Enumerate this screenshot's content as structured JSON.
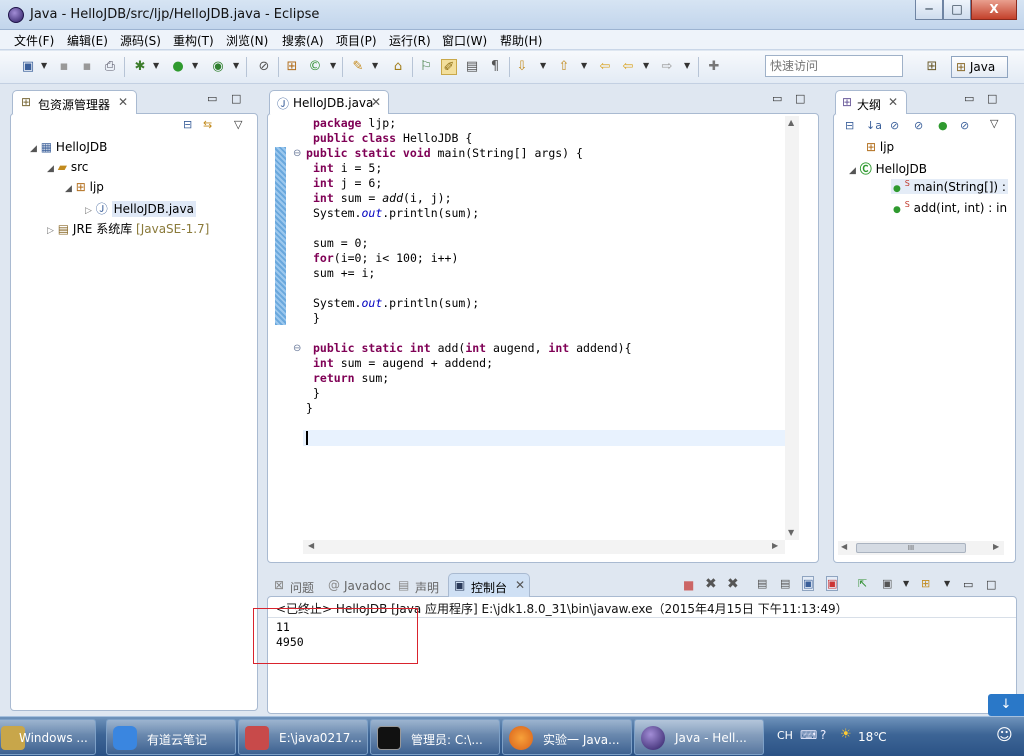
{
  "window": {
    "title": "Java  -  HelloJDB/src/ljp/HelloJDB.java  -  Eclipse",
    "controls": {
      "minimize": "─",
      "maximize": "□",
      "close": "X"
    }
  },
  "menu": [
    "文件(F)",
    "编辑(E)",
    "源码(S)",
    "重构(T)",
    "浏览(N)",
    "搜索(A)",
    "项目(P)",
    "运行(R)",
    "窗口(W)",
    "帮助(H)"
  ],
  "toolbar": {
    "quick_access_placeholder": "快速访问",
    "perspective_label": "Java"
  },
  "package_explorer": {
    "tab_label": "包资源管理器",
    "tree": {
      "project": "HelloJDB",
      "src": "src",
      "package": "ljp",
      "file": "HelloJDB.java",
      "jre": "JRE 系统库",
      "jre_version": "[JavaSE-1.7]"
    }
  },
  "editor": {
    "tab_label": "HelloJDB.java",
    "lines": [
      "package ljp;",
      "public class HelloJDB {",
      "public static void main(String[] args) {",
      "int i = 5;",
      "int j = 6;",
      "int sum = add(i, j);",
      "System.out.println(sum);",
      "",
      "sum = 0;",
      "for(i=0; i< 100; i++)",
      "sum += i;",
      "",
      "System.out.println(sum);",
      "}",
      "",
      "public static int add(int augend, int addend){",
      "int sum = augend + addend;",
      "return sum;",
      "}",
      "}"
    ]
  },
  "outline": {
    "tab_label": "大纲",
    "package": "ljp",
    "class": "HelloJDB",
    "methods": [
      {
        "name": "main(String[]) :",
        "static_mark": "S"
      },
      {
        "name": "add(int, int) : in",
        "static_mark": "S"
      }
    ],
    "scroll_label": "III"
  },
  "bottom_tabs": {
    "problems": "问题",
    "javadoc": "Javadoc",
    "declaration": "声明",
    "console": "控制台"
  },
  "console": {
    "status": "<已终止> HelloJDB [Java 应用程序] E:\\jdk1.8.0_31\\bin\\javaw.exe（2015年4月15日 下午11:13:49）",
    "output": [
      "11",
      "4950"
    ]
  },
  "taskbar": {
    "tasks": [
      "Windows ...",
      "有道云笔记",
      "E:\\java0217...",
      "管理员: C:\\...",
      "实验一 Java...",
      "Java  -  Hell..."
    ],
    "tray": {
      "ime": "CH",
      "temperature": "18℃"
    }
  },
  "colors": {
    "highlight_box": "#d9232d",
    "console_tab": "#cfe0f4",
    "keyword": "#7f0055"
  }
}
